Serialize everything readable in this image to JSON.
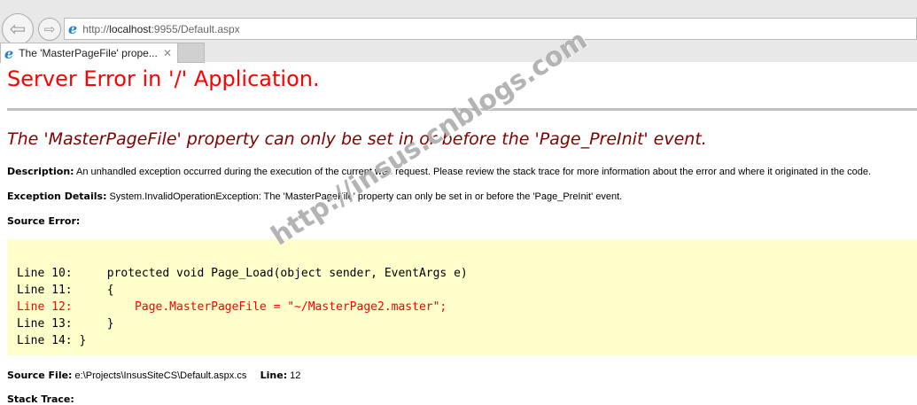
{
  "browser": {
    "url_prefix": "http://",
    "url_host": "localhost",
    "url_rest": ":9955/Default.aspx",
    "tab_title": "The 'MasterPageFile' prope...",
    "back_glyph": "⇦",
    "fwd_glyph": "⇨",
    "ie_glyph": "e",
    "close_glyph": "✕"
  },
  "page": {
    "title": "Server Error in '/' Application.",
    "error_heading": "The 'MasterPageFile' property can only be set in or before the 'Page_PreInit' event.",
    "description_label": "Description:",
    "description": "An unhandled exception occurred during the execution of the current web request. Please review the stack trace for more information about the error and where it originated in the code.",
    "exception_label": "Exception Details:",
    "exception": "System.InvalidOperationException: The 'MasterPageFile' property can only be set in or before the 'Page_PreInit' event.",
    "source_error_label": "Source Error:",
    "code_lines": [
      "Line 10:     protected void Page_Load(object sender, EventArgs e)",
      "Line 11:     {",
      "Line 12:         Page.MasterPageFile = \"~/MasterPage2.master\";",
      "Line 13:     }",
      "Line 14: }"
    ],
    "source_file_label": "Source File:",
    "source_file": "e:\\Projects\\InsusSiteCS\\Default.aspx.cs",
    "line_label": "Line:",
    "line": "12",
    "stack_trace_label": "Stack Trace:"
  },
  "watermark": "http://insus.cnblogs.com"
}
